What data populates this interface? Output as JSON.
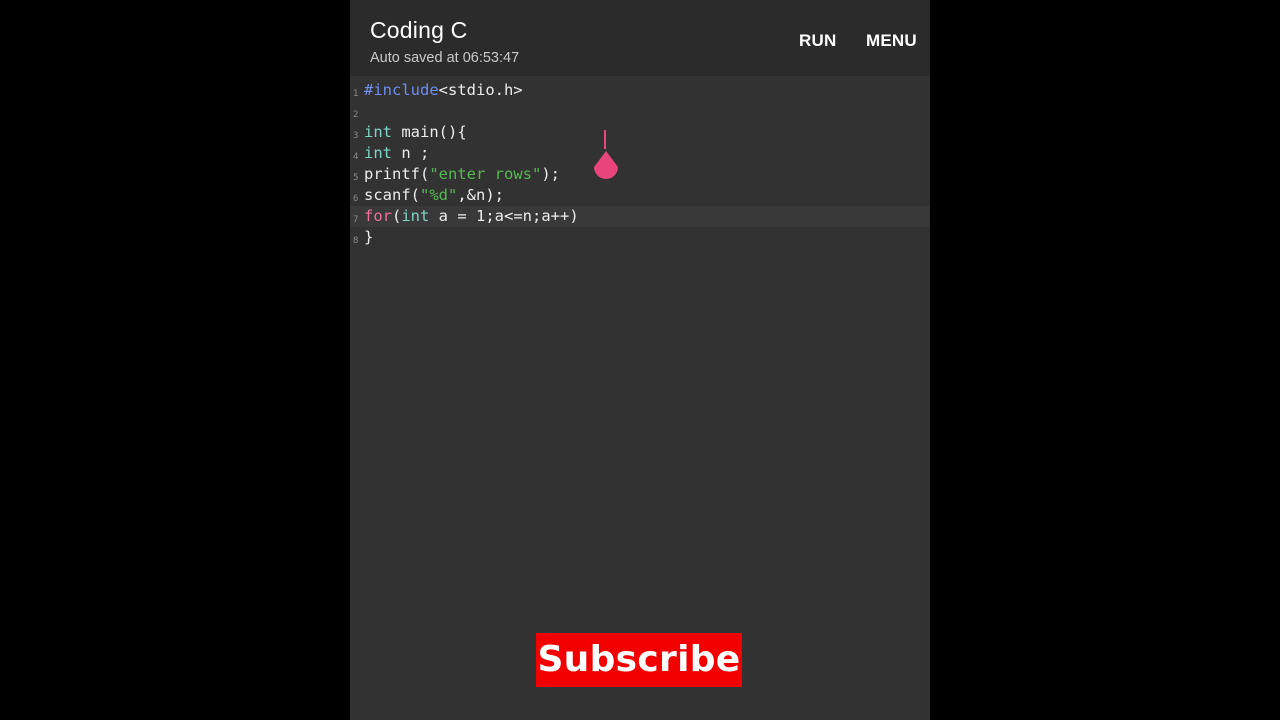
{
  "app": {
    "title": "Coding C",
    "autosave": "Auto saved at 06:53:47"
  },
  "actions": {
    "run": "RUN",
    "menu": "MENU"
  },
  "editor": {
    "active_line": 7,
    "lines": [
      {
        "num": "1",
        "tokens": [
          {
            "t": "#include",
            "c": "pre"
          },
          {
            "t": "<stdio.h>",
            "c": "plain"
          }
        ]
      },
      {
        "num": "2",
        "tokens": []
      },
      {
        "num": "3",
        "tokens": [
          {
            "t": "int",
            "c": "type"
          },
          {
            "t": " main(){",
            "c": "plain"
          }
        ]
      },
      {
        "num": "4",
        "tokens": [
          {
            "t": "int",
            "c": "type"
          },
          {
            "t": " n ;",
            "c": "plain"
          }
        ]
      },
      {
        "num": "5",
        "tokens": [
          {
            "t": "printf(",
            "c": "plain"
          },
          {
            "t": "\"enter rows\"",
            "c": "str"
          },
          {
            "t": ");",
            "c": "plain"
          }
        ]
      },
      {
        "num": "6",
        "tokens": [
          {
            "t": "scanf(",
            "c": "plain"
          },
          {
            "t": "\"%d\"",
            "c": "str"
          },
          {
            "t": ",&n);",
            "c": "plain"
          }
        ]
      },
      {
        "num": "7",
        "tokens": [
          {
            "t": "for",
            "c": "kw"
          },
          {
            "t": "(",
            "c": "plain"
          },
          {
            "t": "int",
            "c": "type"
          },
          {
            "t": " a = 1;a<=n;a++)",
            "c": "plain"
          }
        ]
      },
      {
        "num": "8",
        "tokens": [
          {
            "t": "}",
            "c": "plain"
          }
        ]
      }
    ]
  },
  "overlay": {
    "subscribe": "Subscribe"
  },
  "colors": {
    "background": "#333233",
    "appbar": "#2c2b2c",
    "caret": "#e8457d",
    "subscribe_bg": "#f20000"
  },
  "icons": {
    "caret_handle": "teardrop-handle-icon"
  }
}
